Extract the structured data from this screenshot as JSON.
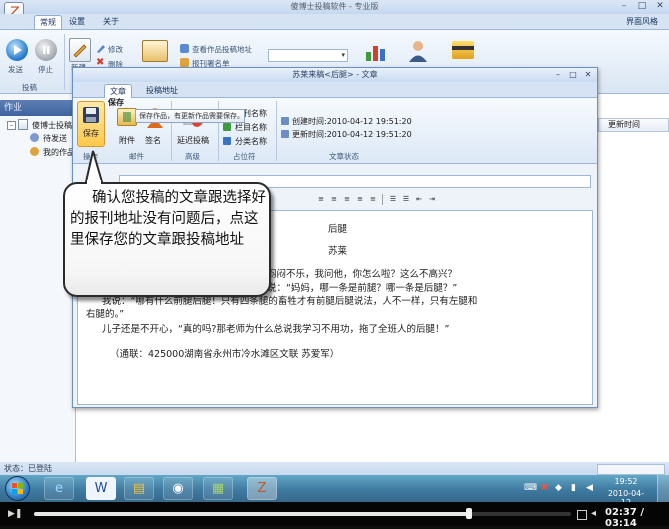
{
  "app": {
    "title": "傻博士投稿软件 - 专业版",
    "menu_tabs": [
      "常规",
      "设置",
      "关于"
    ],
    "skin_label": "界面风格",
    "ribbon": {
      "send": "发送",
      "stop": "停止",
      "group_submit": "投稿",
      "new": "新建",
      "edit": "修改",
      "delete": "删除",
      "view_addresses": "查看作品投稿地址",
      "report_signature": "报刊署名单",
      "select_value": ""
    },
    "left_header": "作业",
    "tree": {
      "root": "傻博士投稿",
      "child1": "待发送",
      "child2": "我的作品"
    },
    "right_header": "更新时间",
    "status": "状态：已登陆"
  },
  "dialog": {
    "title": "苏莱来稿<后腿> - 文章",
    "tabs": [
      "文章",
      "投稿地址"
    ],
    "buttons": {
      "save": "保存",
      "attach": "附件",
      "sign": "签名",
      "delay": "延迟投稿"
    },
    "place_items": [
      "报刊名称",
      "栏目名称",
      "分类名称"
    ],
    "status_items": {
      "created": "创建时间:2010-04-12 19:51:20",
      "updated": "更新时间:2010-04-12 19:51:20"
    },
    "groups": [
      "操作",
      "邮件",
      "高级",
      "占位符",
      "文章状态"
    ],
    "tooltip_title": "保存",
    "tooltip_body": "保存作品，有更新作品需要保存。",
    "article": {
      "title": "后腿",
      "author": "苏莱",
      "lines": [
        "儿子闷闷不乐，我问他，你怎么啦？这么不高兴？",
        "儿子说：“妈妈，哪一条是前腿？哪一条是后腿？”",
        "我说：“哪有什么前腿后腿！只有四条腿的畜牲才有前腿后腿说法，人不一样，只有左腿和",
        "右腿的。”",
        "儿子还是不开心，“真的吗?那老师为什么总说我学习不用功，拖了全班人的后腿！”",
        "（通联：425000湖南省永州市冷水滩区文联  苏爱军）"
      ]
    }
  },
  "callout": {
    "text": "确认您投稿的文章跟选择好的报刊地址没有问题后，点这里保存您的文章跟投稿地址"
  },
  "taskbar": {
    "time": "19:52",
    "date": "2010-04-12"
  },
  "player": {
    "time": "02:37 / 03:14",
    "progress": 0.81
  }
}
